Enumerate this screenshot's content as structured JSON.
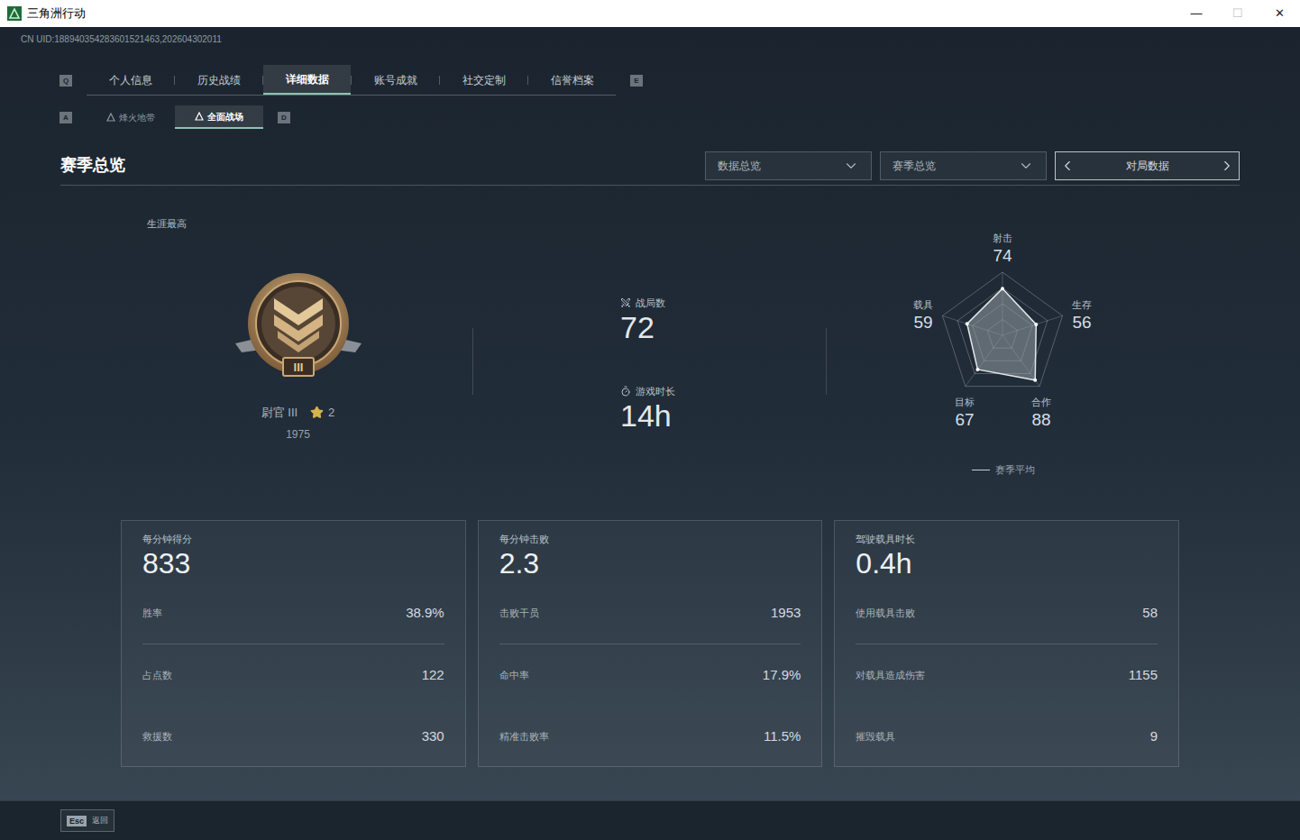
{
  "window": {
    "title": "三角洲行动",
    "controls": [
      {
        "glyph": "—",
        "disabled": false
      },
      {
        "glyph": "☐",
        "disabled": true
      },
      {
        "glyph": "✕",
        "disabled": false
      }
    ]
  },
  "uid": "CN UID:188940354283601521463,202604302011",
  "tabs": {
    "prev_key": "Q",
    "next_key": "E",
    "items": [
      {
        "label": "个人信息",
        "selected": false
      },
      {
        "label": "历史战绩",
        "selected": false
      },
      {
        "label": "详细数据",
        "selected": true
      },
      {
        "label": "账号成就",
        "selected": false
      },
      {
        "label": "社交定制",
        "selected": false
      },
      {
        "label": "信誉档案",
        "selected": false
      }
    ]
  },
  "sub_tabs": {
    "prev_key": "A",
    "next_key": "D",
    "items": [
      {
        "label": "烽火地带",
        "selected": false
      },
      {
        "label": "全面战场",
        "selected": true
      }
    ]
  },
  "header": {
    "title": "赛季总览",
    "dropdowns": [
      {
        "value": "数据总览"
      },
      {
        "value": "赛季总览"
      }
    ],
    "pager": {
      "label": "对局数据"
    }
  },
  "rank": {
    "caption": "生涯最高",
    "name": "尉官 III",
    "badge_numeral": "III",
    "stars": "2",
    "score": "1975"
  },
  "summary": [
    {
      "kind": "count",
      "label": "战局数",
      "value": "72"
    },
    {
      "kind": "duration",
      "label": "游戏时长",
      "value": "14h"
    }
  ],
  "radar": {
    "axes": [
      {
        "label": "射击",
        "value": "74"
      },
      {
        "label": "生存",
        "value": "56"
      },
      {
        "label": "合作",
        "value": "88"
      },
      {
        "label": "目标",
        "value": "67"
      },
      {
        "label": "载具",
        "value": "59"
      }
    ],
    "series": [
      {
        "values": [
          74,
          56,
          88,
          67,
          59
        ]
      }
    ],
    "legend": "赛季平均"
  },
  "cards": [
    {
      "title": "每分钟得分",
      "value": "833",
      "rows": [
        {
          "label": "胜率",
          "value": "38.9%"
        },
        {
          "label": "占点数",
          "value": "122"
        },
        {
          "label": "救援数",
          "value": "330"
        }
      ]
    },
    {
      "title": "每分钟击败",
      "value": "2.3",
      "rows": [
        {
          "label": "击败干员",
          "value": "1953"
        },
        {
          "label": "命中率",
          "value": "17.9%"
        },
        {
          "label": "精准击败率",
          "value": "11.5%"
        }
      ]
    },
    {
      "title": "驾驶载具时长",
      "value": "0.4h",
      "rows": [
        {
          "label": "使用载具击败",
          "value": "58"
        },
        {
          "label": "对载具造成伤害",
          "value": "1155"
        },
        {
          "label": "摧毁载具",
          "value": "9"
        }
      ]
    }
  ],
  "footer": {
    "key": "Esc",
    "label": "返回"
  }
}
